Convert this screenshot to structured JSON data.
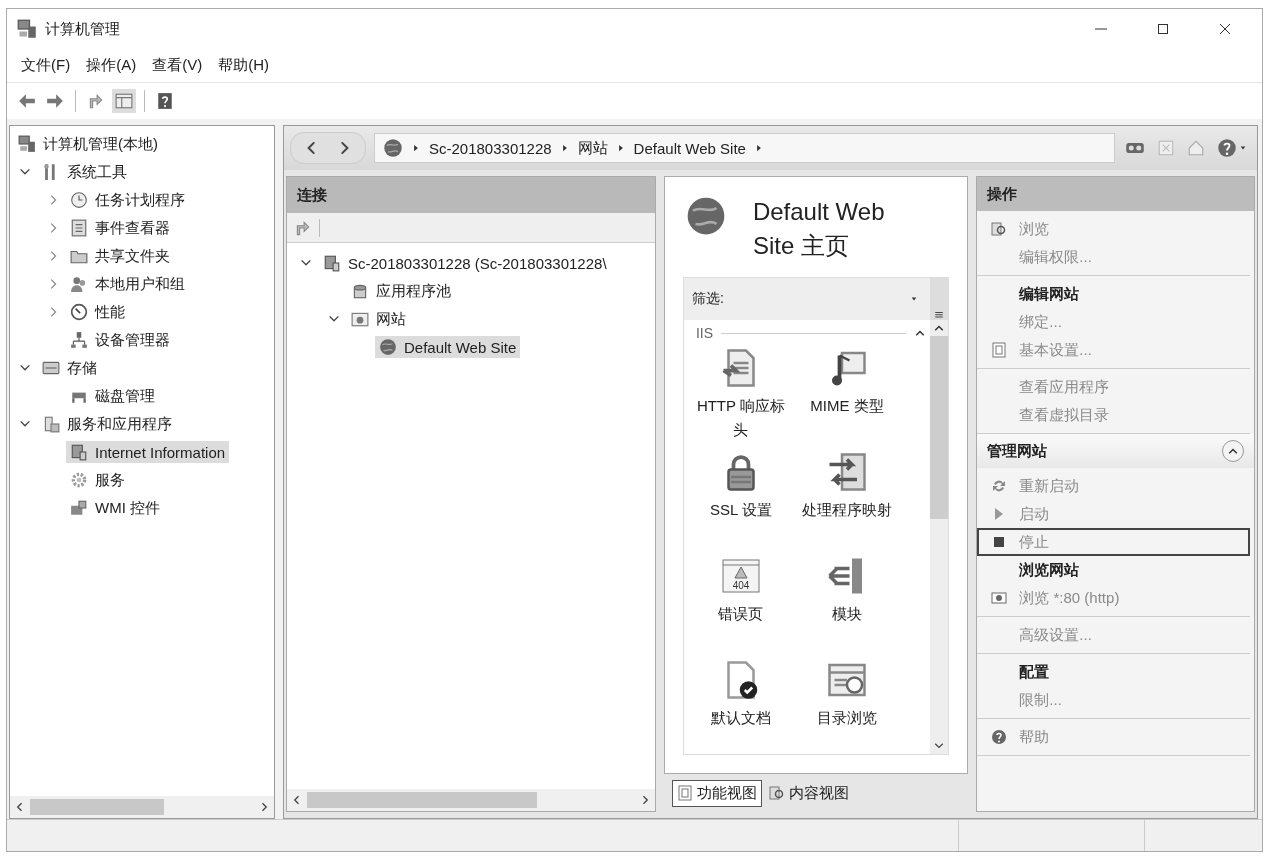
{
  "window": {
    "title": "计算机管理"
  },
  "menu": [
    "文件(F)",
    "操作(A)",
    "查看(V)",
    "帮助(H)"
  ],
  "tree": {
    "items": [
      {
        "label": "计算机管理(本地)",
        "selected": false,
        "children": [
          {
            "label": "系统工具",
            "expanded": true,
            "selected": false,
            "children": [
              {
                "label": "任务计划程序",
                "expanded": false,
                "selected": false
              },
              {
                "label": "事件查看器",
                "expanded": false,
                "selected": false
              },
              {
                "label": "共享文件夹",
                "expanded": false,
                "selected": false
              },
              {
                "label": "本地用户和组",
                "expanded": false,
                "selected": false
              },
              {
                "label": "性能",
                "expanded": false,
                "selected": false
              },
              {
                "label": "设备管理器",
                "selected": false
              }
            ]
          },
          {
            "label": "存储",
            "expanded": true,
            "selected": false,
            "children": [
              {
                "label": "磁盘管理",
                "selected": false
              }
            ]
          },
          {
            "label": "服务和应用程序",
            "expanded": true,
            "selected": false,
            "children": [
              {
                "label": "Internet Information",
                "selected": true
              },
              {
                "label": "服务",
                "selected": false
              },
              {
                "label": "WMI 控件",
                "selected": false
              }
            ]
          }
        ]
      }
    ]
  },
  "address": {
    "breadcrumb": [
      "Sc-201803301228",
      "网站",
      "Default Web Site"
    ]
  },
  "connections": {
    "title": "连接",
    "tree": [
      {
        "label": "Sc-201803301228 (Sc-201803301228\\",
        "expanded": true,
        "selected": false,
        "children": [
          {
            "label": "应用程序池",
            "selected": false
          },
          {
            "label": "网站",
            "expanded": true,
            "selected": false,
            "children": [
              {
                "label": "Default Web Site",
                "selected": true
              }
            ]
          }
        ]
      }
    ]
  },
  "features": {
    "title": "Default Web Site 主页",
    "filter_label": "筛选:",
    "group": {
      "label": "IIS",
      "expanded": true
    },
    "items": [
      {
        "label": "HTTP 响应标头"
      },
      {
        "label": "MIME 类型"
      },
      {
        "label": "SSL 设置"
      },
      {
        "label": "处理程序映射"
      },
      {
        "label": "错误页",
        "badge": "404"
      },
      {
        "label": "模块"
      },
      {
        "label": "默认文档"
      },
      {
        "label": "目录浏览"
      }
    ],
    "views": [
      {
        "label": "功能视图",
        "selected": true
      },
      {
        "label": "内容视图",
        "selected": false
      }
    ]
  },
  "actions": {
    "title": "操作",
    "sections": [
      {
        "items": [
          {
            "kind": "link",
            "label": "浏览"
          },
          {
            "kind": "link",
            "label": "编辑权限..."
          }
        ]
      },
      {
        "items": [
          {
            "kind": "header",
            "label": "编辑网站"
          },
          {
            "kind": "link",
            "label": "绑定..."
          },
          {
            "kind": "link",
            "label": "基本设置..."
          }
        ]
      },
      {
        "items": [
          {
            "kind": "link",
            "label": "查看应用程序"
          },
          {
            "kind": "link",
            "label": "查看虚拟目录"
          }
        ]
      },
      {
        "title": "管理网站",
        "expanded": true,
        "items": [
          {
            "kind": "link",
            "label": "重新启动",
            "hovered": false
          },
          {
            "kind": "link",
            "label": "启动",
            "hovered": false
          },
          {
            "kind": "link",
            "label": "停止",
            "hovered": true
          },
          {
            "kind": "header",
            "label": "浏览网站",
            "hovered": false
          },
          {
            "kind": "link",
            "label": "浏览 *:80 (http)",
            "hovered": false
          }
        ]
      },
      {
        "items": [
          {
            "kind": "link",
            "label": "高级设置..."
          }
        ]
      },
      {
        "items": [
          {
            "kind": "header",
            "label": "配置"
          },
          {
            "kind": "link",
            "label": "限制..."
          }
        ]
      },
      {
        "items": [
          {
            "kind": "link",
            "label": "帮助"
          }
        ]
      }
    ]
  }
}
